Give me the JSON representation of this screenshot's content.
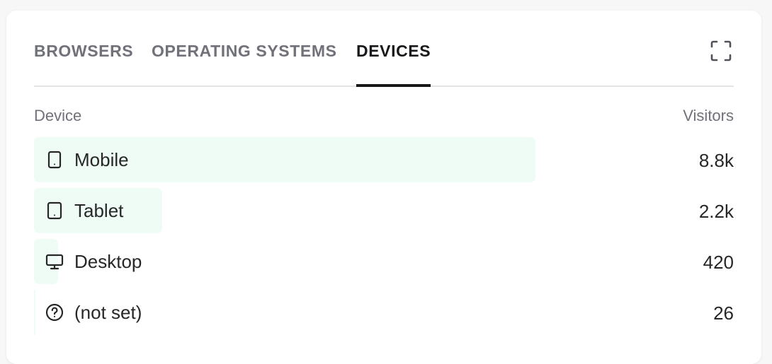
{
  "tabs": [
    {
      "label": "BROWSERS",
      "active": false
    },
    {
      "label": "OPERATING SYSTEMS",
      "active": false
    },
    {
      "label": "DEVICES",
      "active": true
    }
  ],
  "expand_icon": "expand-icon",
  "table": {
    "columns": [
      "Device",
      "Visitors"
    ],
    "rows": [
      {
        "label": "Mobile",
        "value": "8.8k",
        "icon": "mobile-icon",
        "share": 0.717
      },
      {
        "label": "Tablet",
        "value": "2.2k",
        "icon": "tablet-icon",
        "share": 0.183
      },
      {
        "label": "Desktop",
        "value": "420",
        "icon": "desktop-icon",
        "share": 0.034
      },
      {
        "label": "(not set)",
        "value": "26",
        "icon": "question-icon",
        "share": 0.002
      }
    ]
  },
  "colors": {
    "bar": "#effcf5",
    "active_tab": "#18181b",
    "inactive_tab": "#71717a"
  }
}
